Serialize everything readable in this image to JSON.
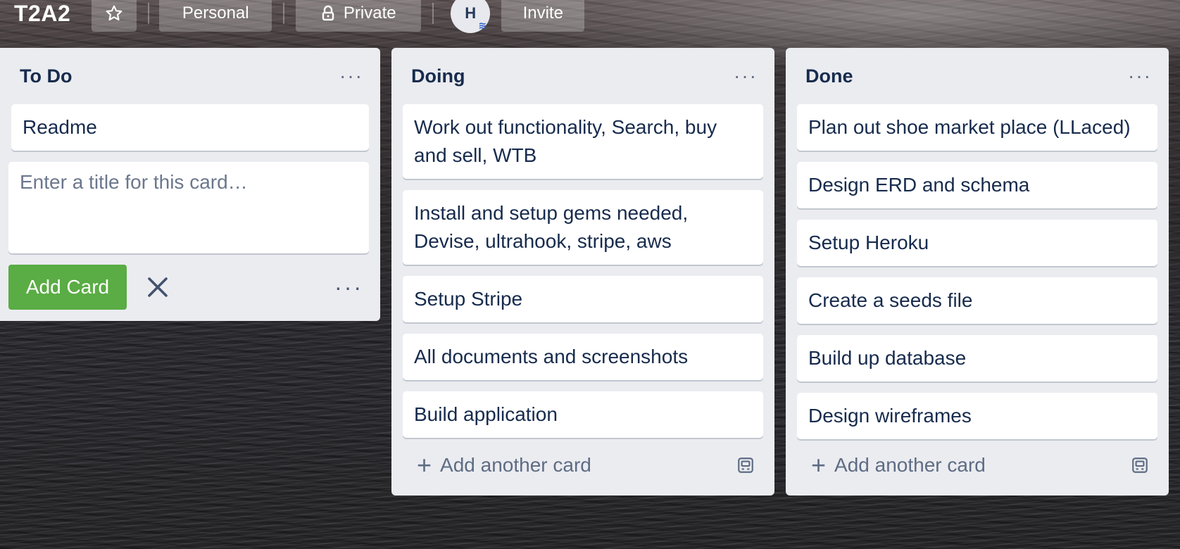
{
  "board": {
    "title": "T2A2",
    "personal_label": "Personal",
    "private_label": "Private",
    "avatar_initial": "H",
    "invite_label": "Invite"
  },
  "lists": {
    "todo": {
      "title": "To Do",
      "cards": [
        "Readme"
      ],
      "composer_placeholder": "Enter a title for this card…",
      "add_card_label": "Add Card"
    },
    "doing": {
      "title": "Doing",
      "cards": [
        "Work out functionality, Search, buy and sell, WTB",
        "Install and setup gems needed, Devise, ultrahook, stripe, aws",
        "Setup Stripe",
        "All documents and screenshots",
        "Build application"
      ],
      "add_another_label": "Add another card"
    },
    "done": {
      "title": "Done",
      "cards": [
        "Plan out shoe market place (LLaced)",
        "Design ERD and schema",
        "Setup Heroku",
        "Create a seeds file",
        "Build up database",
        "Design wireframes"
      ],
      "add_another_label": "Add another card"
    }
  },
  "icons": {
    "star": "star-icon",
    "lock": "lock-icon",
    "menu": "more-horizontal-icon",
    "close": "close-icon",
    "plus": "plus-icon",
    "template": "card-template-icon"
  },
  "colors": {
    "list_bg": "#ebecf0",
    "card_text": "#172b4d",
    "add_button": "#5aac44"
  }
}
